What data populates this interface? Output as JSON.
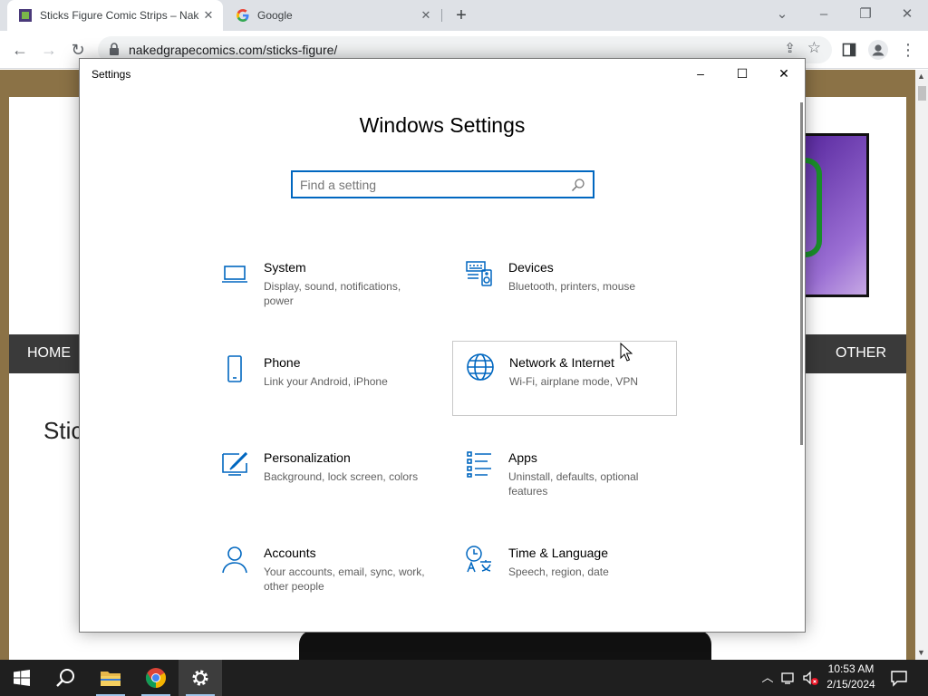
{
  "browser": {
    "tabs": [
      {
        "title": "Sticks Figure Comic Strips – Naked Grape Comics",
        "active": true
      },
      {
        "title": "Google",
        "active": false
      }
    ],
    "url": "nakedgrapecomics.com/sticks-figure/"
  },
  "webpage": {
    "nav_home": "HOME",
    "nav_other": "OTHER",
    "heading_partial": "Stic"
  },
  "settings": {
    "window_title": "Settings",
    "heading": "Windows Settings",
    "search_placeholder": "Find a setting",
    "categories": [
      {
        "name": "System",
        "desc": "Display, sound, notifications, power",
        "icon": "laptop-icon"
      },
      {
        "name": "Devices",
        "desc": "Bluetooth, printers, mouse",
        "icon": "devices-icon"
      },
      {
        "name": "Phone",
        "desc": "Link your Android, iPhone",
        "icon": "phone-icon"
      },
      {
        "name": "Network & Internet",
        "desc": "Wi-Fi, airplane mode, VPN",
        "icon": "globe-icon"
      },
      {
        "name": "Personalization",
        "desc": "Background, lock screen, colors",
        "icon": "paintbrush-icon"
      },
      {
        "name": "Apps",
        "desc": "Uninstall, defaults, optional features",
        "icon": "apps-list-icon"
      },
      {
        "name": "Accounts",
        "desc": "Your accounts, email, sync, work, other people",
        "icon": "person-icon"
      },
      {
        "name": "Time & Language",
        "desc": "Speech, region, date",
        "icon": "time-language-icon"
      }
    ]
  },
  "taskbar": {
    "time": "10:53 AM",
    "date": "2/15/2024"
  },
  "colors": {
    "accent": "#0067c0",
    "taskbar": "#1f1f1f",
    "page_border": "#8b7246"
  }
}
